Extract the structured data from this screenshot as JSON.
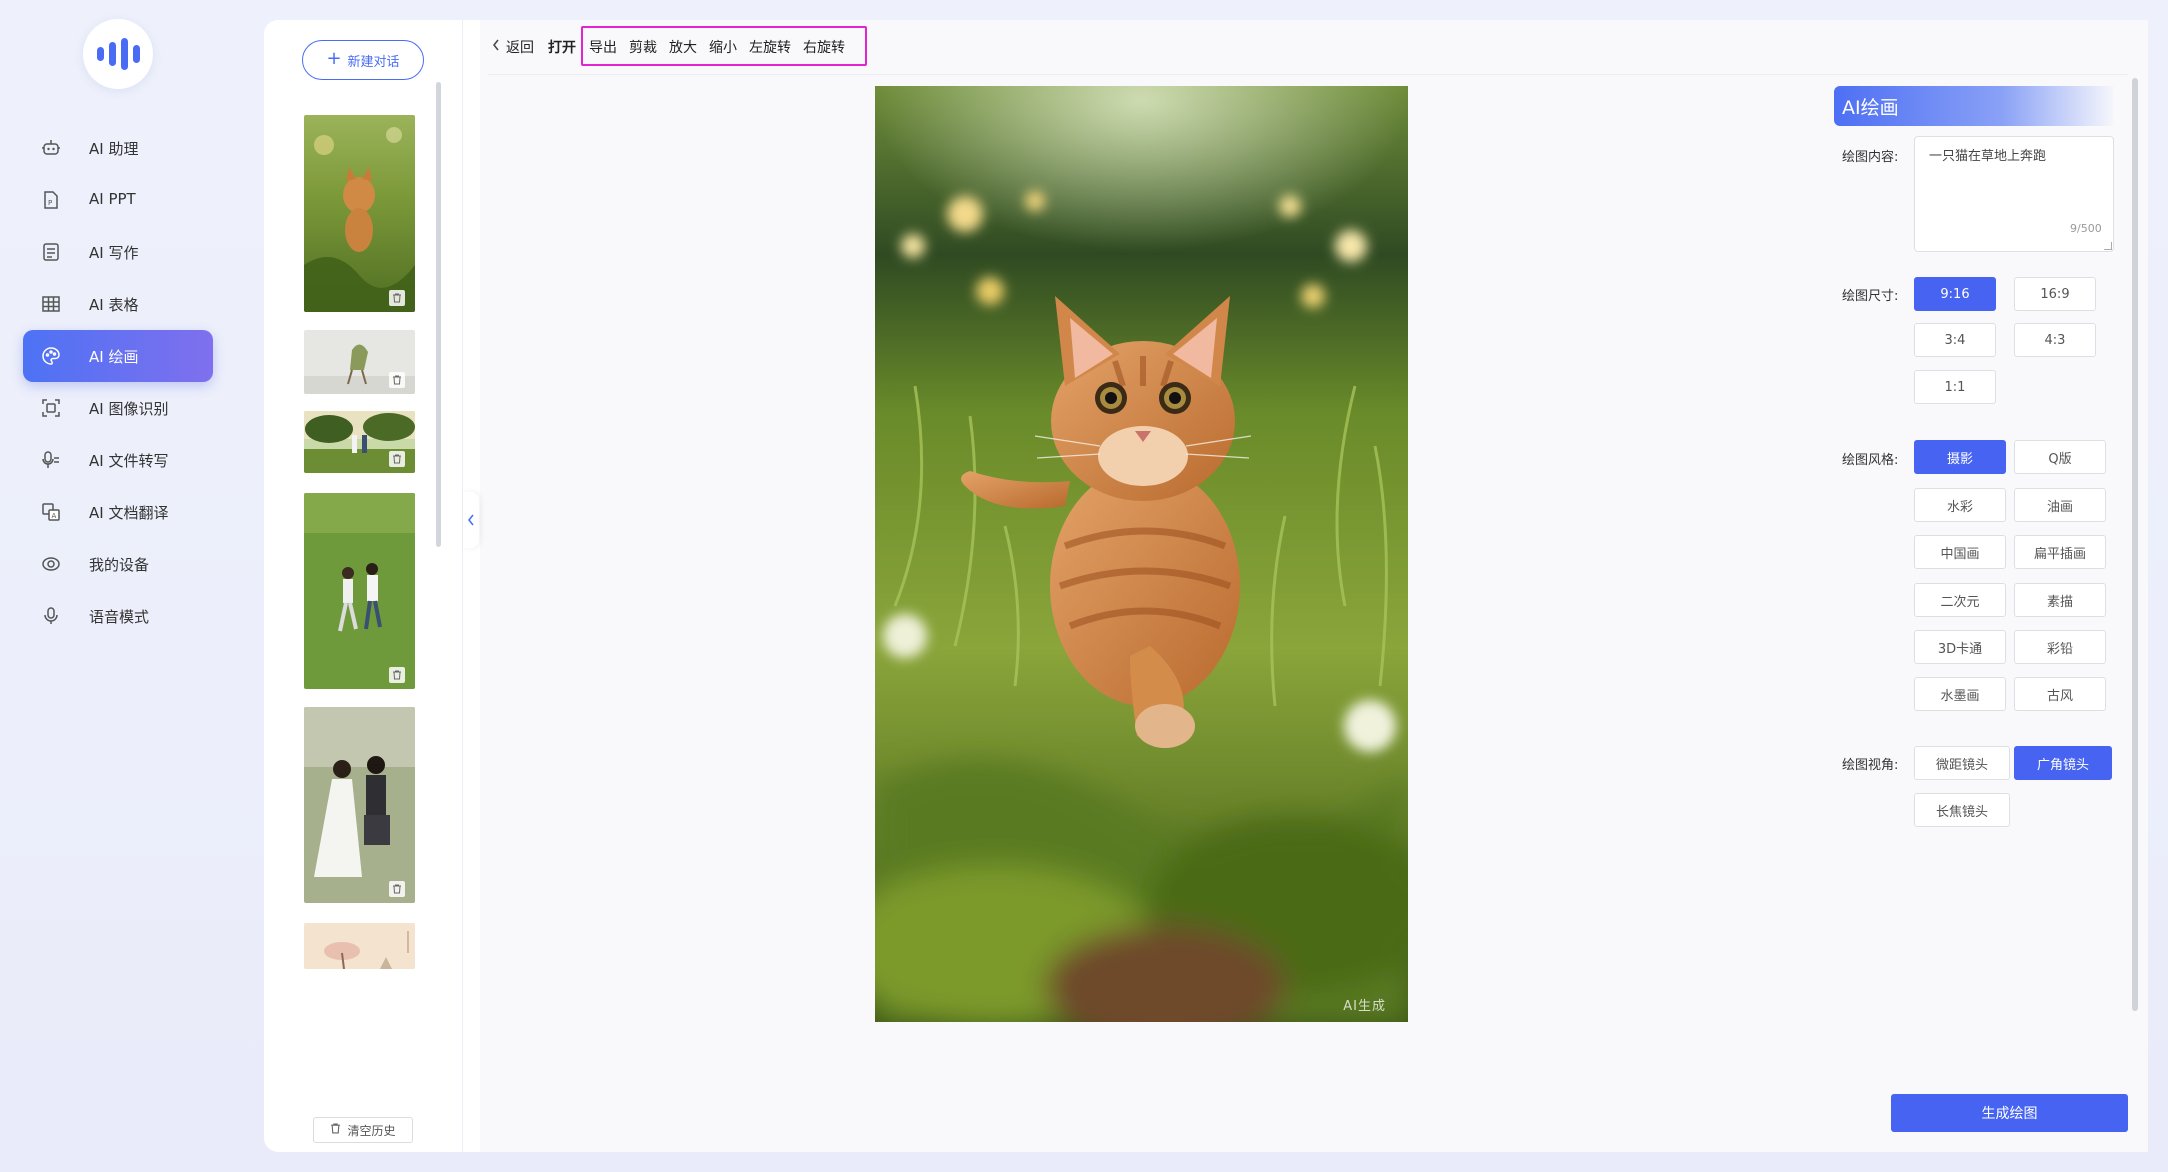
{
  "nav": {
    "items": [
      {
        "label": "AI 助理",
        "icon": "robot-icon"
      },
      {
        "label": "AI PPT",
        "icon": "ppt-file-icon"
      },
      {
        "label": "AI 写作",
        "icon": "document-icon"
      },
      {
        "label": "AI 表格",
        "icon": "table-icon"
      },
      {
        "label": "AI 绘画",
        "icon": "palette-icon"
      },
      {
        "label": "AI 图像识别",
        "icon": "scan-icon"
      },
      {
        "label": "AI 文件转写",
        "icon": "mic-file-icon"
      },
      {
        "label": "AI 文档翻译",
        "icon": "translate-icon"
      },
      {
        "label": "我的设备",
        "icon": "device-icon"
      },
      {
        "label": "语音模式",
        "icon": "microphone-icon"
      }
    ],
    "active_index": 4
  },
  "history": {
    "new_chat_label": "新建对话",
    "clear_label": "清空历史"
  },
  "toolbar": {
    "back_label": "返回",
    "open_label": "打开",
    "export_label": "导出",
    "crop_label": "剪裁",
    "zoom_in_label": "放大",
    "zoom_out_label": "缩小",
    "rotate_left_label": "左旋转",
    "rotate_right_label": "右旋转"
  },
  "canvas": {
    "watermark": "AI生成"
  },
  "settings": {
    "title": "AI绘画",
    "content_label": "绘图内容:",
    "content_value": "一只猫在草地上奔跑",
    "content_count": "9/500",
    "size_label": "绘图尺寸:",
    "sizes": [
      "9:16",
      "16:9",
      "3:4",
      "4:3",
      "1:1"
    ],
    "size_selected": "9:16",
    "style_label": "绘图风格:",
    "styles": [
      "摄影",
      "Q版",
      "水彩",
      "油画",
      "中国画",
      "扁平插画",
      "二次元",
      "素描",
      "3D卡通",
      "彩铅",
      "水墨画",
      "古风"
    ],
    "style_selected": "摄影",
    "view_label": "绘图视角:",
    "views": [
      "微距镜头",
      "广角镜头",
      "长焦镜头"
    ],
    "view_selected": "广角镜头",
    "generate_label": "生成绘图"
  },
  "colors": {
    "accent": "#4763f1",
    "highlight_box": "#e224d4"
  }
}
